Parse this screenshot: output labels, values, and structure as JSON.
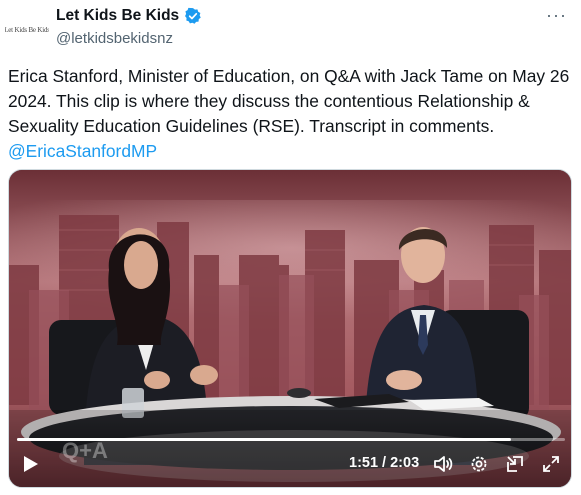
{
  "author": {
    "display_name": "Let Kids Be Kids",
    "handle": "@letkidsbekidsnz",
    "avatar_text": "Let Kids Be Kids",
    "verified": true
  },
  "tweet": {
    "text": "Erica Stanford, Minister of Education, on Q&A with Jack Tame on May 26 2024. This clip is where they discuss the contentious Relationship & Sexuality Education Guidelines (RSE). Transcript in comments.",
    "mention": "@EricaStanfordMP"
  },
  "video": {
    "watermark": "Q+A",
    "time": "1:51 / 2:03",
    "progress": 0.902,
    "icons": [
      "play-icon",
      "volume-icon",
      "settings-icon",
      "exit-picture-icon",
      "fullscreen-icon"
    ]
  },
  "menu": {
    "more_label": "···"
  },
  "colors": {
    "link": "#1d9bf0",
    "verified": "#1d9bf0",
    "secondary_text": "#536471"
  }
}
